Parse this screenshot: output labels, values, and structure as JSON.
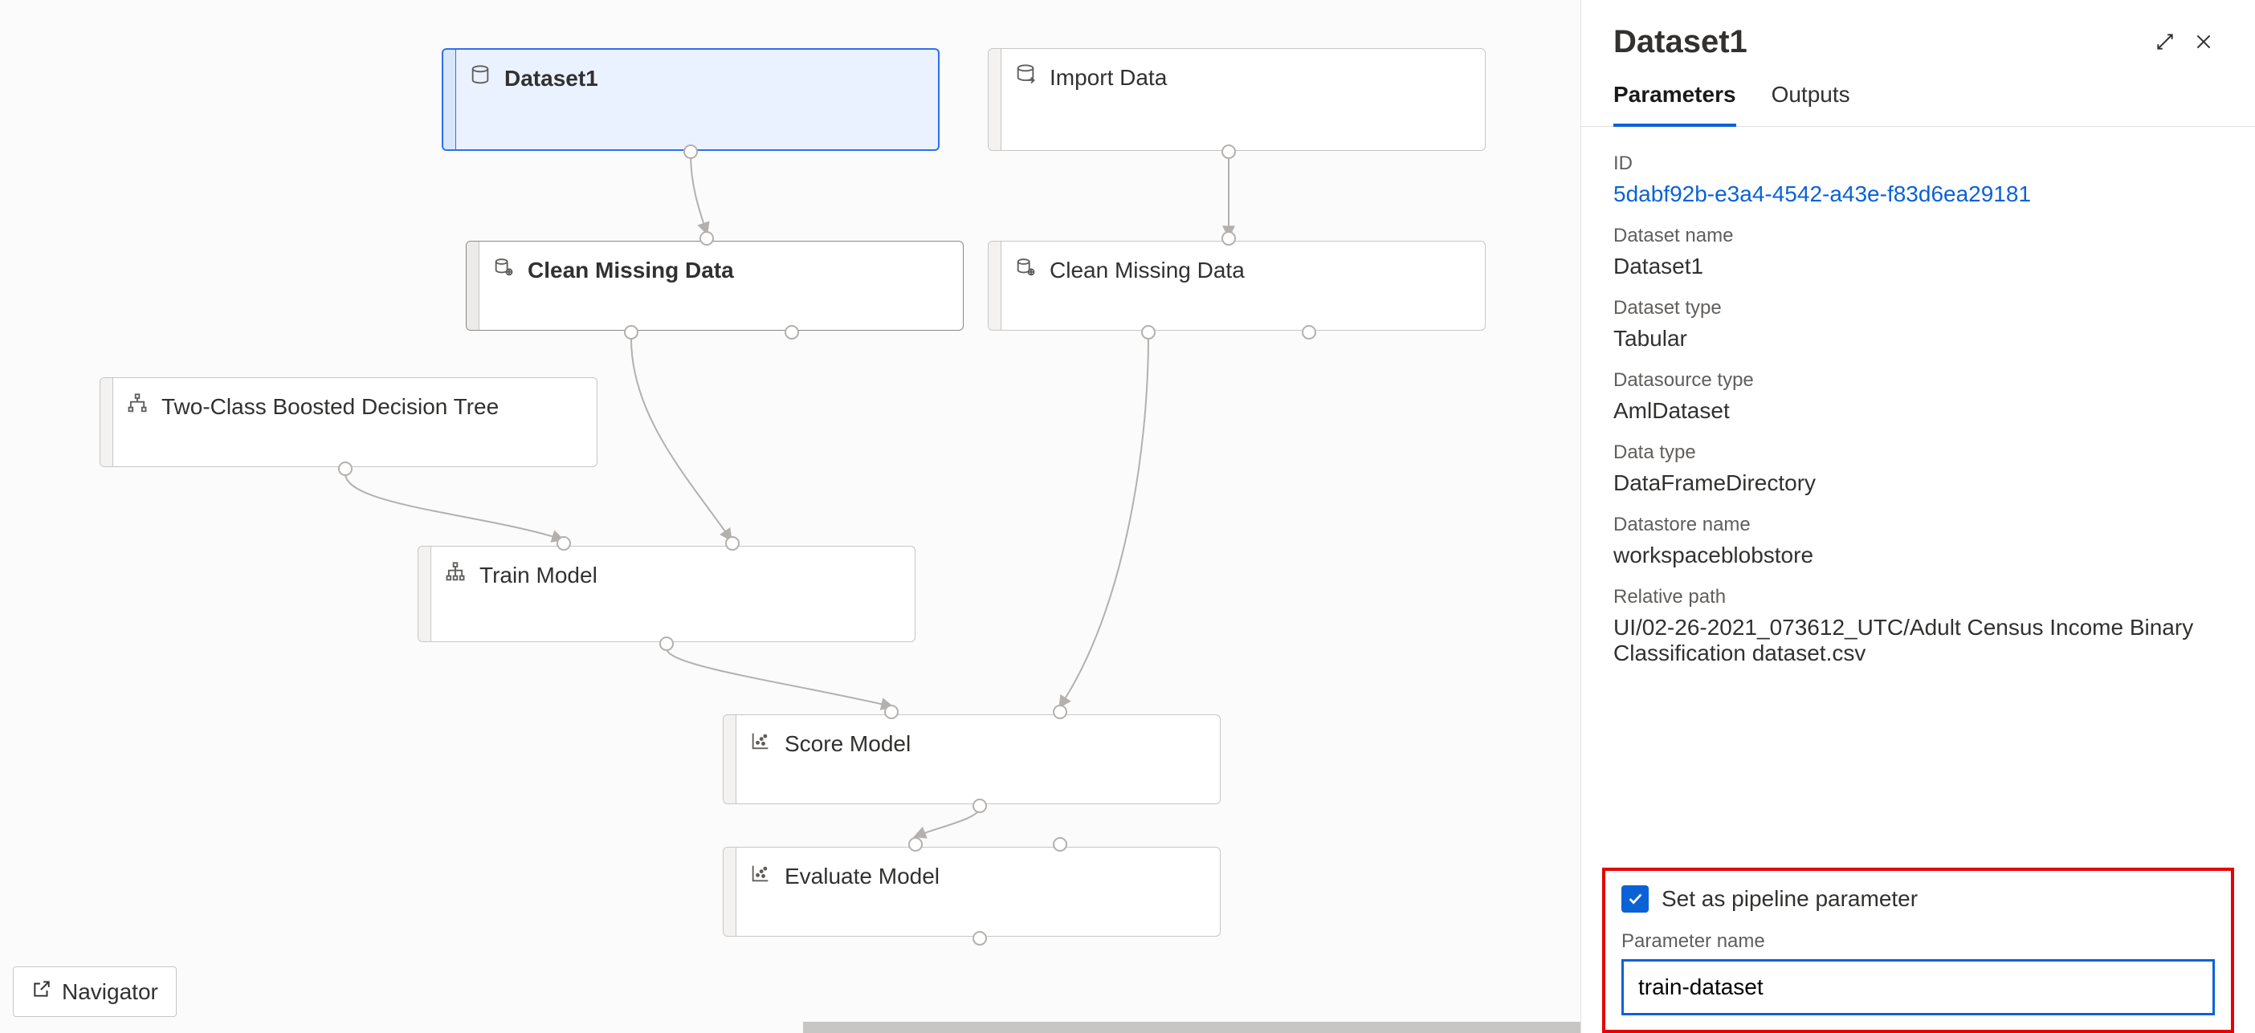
{
  "canvas": {
    "nodes": {
      "dataset1": {
        "label": "Dataset1"
      },
      "import_data": {
        "label": "Import Data"
      },
      "clean1": {
        "label": "Clean Missing Data"
      },
      "clean2": {
        "label": "Clean Missing Data"
      },
      "bdt": {
        "label": "Two-Class Boosted Decision Tree"
      },
      "train": {
        "label": "Train Model"
      },
      "score": {
        "label": "Score Model"
      },
      "evaluate": {
        "label": "Evaluate Model"
      }
    },
    "navigator_label": "Navigator"
  },
  "side": {
    "title": "Dataset1",
    "tabs": {
      "parameters": "Parameters",
      "outputs": "Outputs"
    },
    "props": {
      "id_label": "ID",
      "id_value": "5dabf92b-e3a4-4542-a43e-f83d6ea29181",
      "dsname_label": "Dataset name",
      "dsname_value": "Dataset1",
      "dstype_label": "Dataset type",
      "dstype_value": "Tabular",
      "srctype_label": "Datasource type",
      "srctype_value": "AmlDataset",
      "dtype_label": "Data type",
      "dtype_value": "DataFrameDirectory",
      "store_label": "Datastore name",
      "store_value": "workspaceblobstore",
      "relpath_label": "Relative path",
      "relpath_value": "UI/02-26-2021_073612_UTC/Adult Census Income Binary Classification dataset.csv"
    },
    "param": {
      "checkbox_label": "Set as pipeline parameter",
      "name_label": "Parameter name",
      "name_value": "train-dataset"
    }
  }
}
